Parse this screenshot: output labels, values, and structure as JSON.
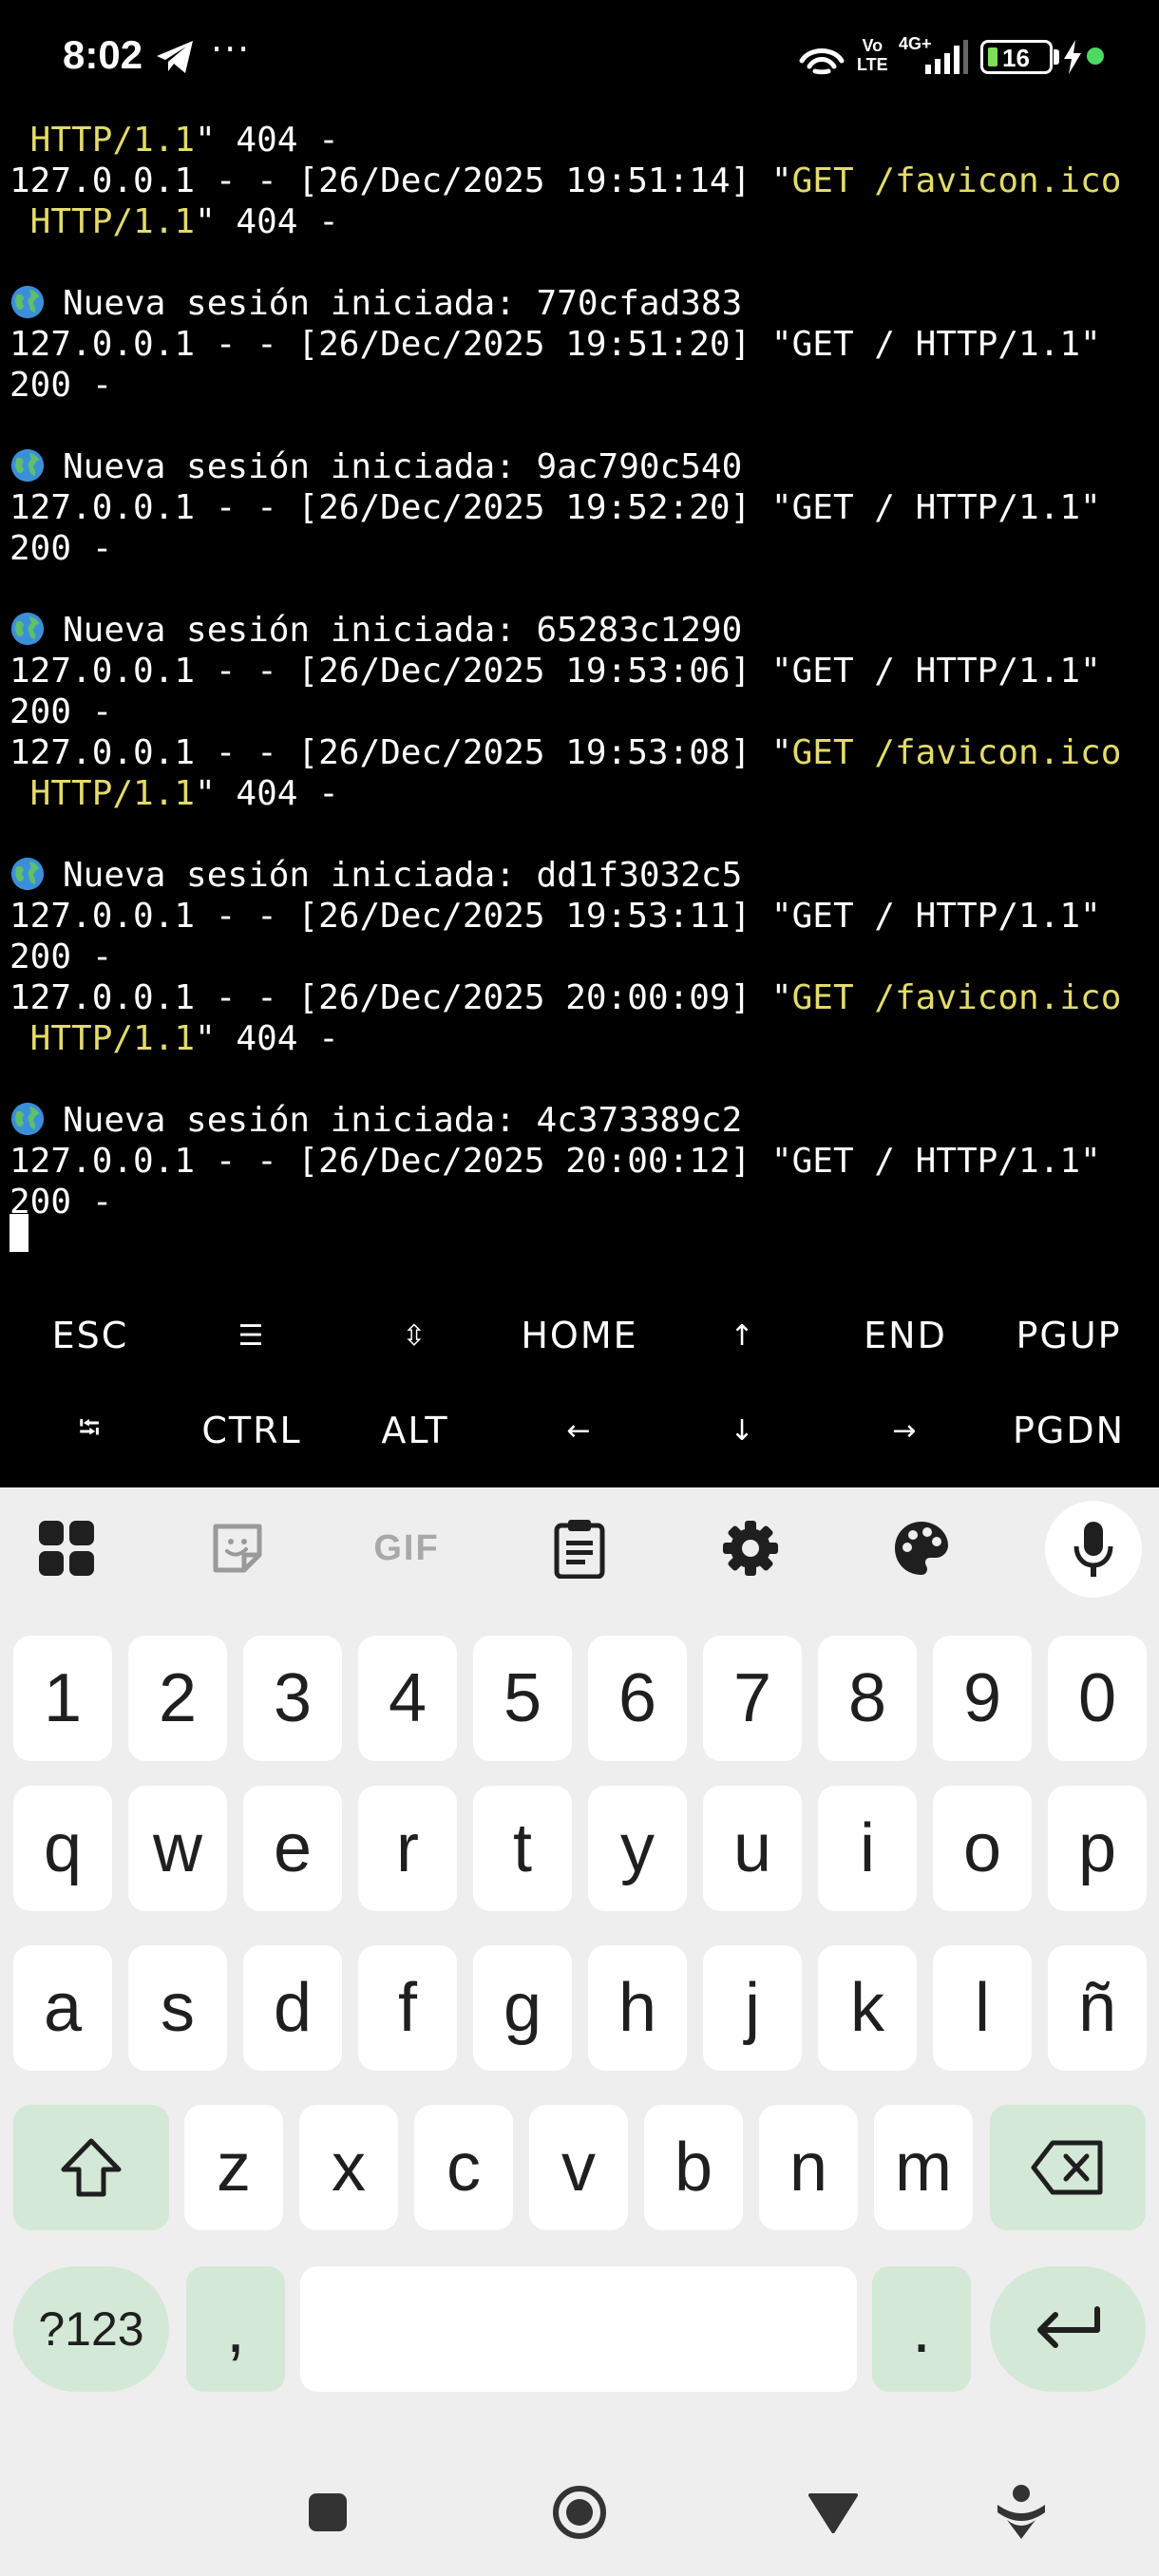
{
  "status_bar": {
    "time": "8:02",
    "overflow": "···",
    "volte": [
      "Vo",
      "LTE"
    ],
    "network": "4G+",
    "battery_level": "16",
    "icons": [
      "telegram-icon",
      "wifi-calling-icon",
      "signal-icon",
      "battery-icon",
      "charging-icon"
    ],
    "dot_color": "#4cd964"
  },
  "terminal": {
    "text_color": "#ffffff",
    "highlight_color": "#e3db6a",
    "lines": [
      {
        "prefix": "",
        "highlight": " HTTP/1.1",
        "suffix": "\" 404 -"
      },
      {
        "prefix": "127.0.0.1 - - [26/Dec/2025 19:51:14] \"",
        "highlight": "GET /favicon.ico",
        "suffix": ""
      },
      {
        "prefix": "",
        "highlight": " HTTP/1.1",
        "suffix": "\" 404 -"
      },
      {
        "prefix": "",
        "highlight": "",
        "suffix": ""
      },
      {
        "globe": true,
        "prefix": "Nueva sesión iniciada: 770cfad383",
        "highlight": "",
        "suffix": ""
      },
      {
        "prefix": "127.0.0.1 - - [26/Dec/2025 19:51:20] \"GET / HTTP/1.1\"",
        "highlight": "",
        "suffix": ""
      },
      {
        "prefix": "200 -",
        "highlight": "",
        "suffix": ""
      },
      {
        "prefix": "",
        "highlight": "",
        "suffix": ""
      },
      {
        "globe": true,
        "prefix": "Nueva sesión iniciada: 9ac790c540",
        "highlight": "",
        "suffix": ""
      },
      {
        "prefix": "127.0.0.1 - - [26/Dec/2025 19:52:20] \"GET / HTTP/1.1\"",
        "highlight": "",
        "suffix": ""
      },
      {
        "prefix": "200 -",
        "highlight": "",
        "suffix": ""
      },
      {
        "prefix": "",
        "highlight": "",
        "suffix": ""
      },
      {
        "globe": true,
        "prefix": "Nueva sesión iniciada: 65283c1290",
        "highlight": "",
        "suffix": ""
      },
      {
        "prefix": "127.0.0.1 - - [26/Dec/2025 19:53:06] \"GET / HTTP/1.1\"",
        "highlight": "",
        "suffix": ""
      },
      {
        "prefix": "200 -",
        "highlight": "",
        "suffix": ""
      },
      {
        "prefix": "127.0.0.1 - - [26/Dec/2025 19:53:08] \"",
        "highlight": "GET /favicon.ico",
        "suffix": ""
      },
      {
        "prefix": "",
        "highlight": " HTTP/1.1",
        "suffix": "\" 404 -"
      },
      {
        "prefix": "",
        "highlight": "",
        "suffix": ""
      },
      {
        "globe": true,
        "prefix": "Nueva sesión iniciada: dd1f3032c5",
        "highlight": "",
        "suffix": ""
      },
      {
        "prefix": "127.0.0.1 - - [26/Dec/2025 19:53:11] \"GET / HTTP/1.1\"",
        "highlight": "",
        "suffix": ""
      },
      {
        "prefix": "200 -",
        "highlight": "",
        "suffix": ""
      },
      {
        "prefix": "127.0.0.1 - - [26/Dec/2025 20:00:09] \"",
        "highlight": "GET /favicon.ico",
        "suffix": ""
      },
      {
        "prefix": "",
        "highlight": " HTTP/1.1",
        "suffix": "\" 404 -"
      },
      {
        "prefix": "",
        "highlight": "",
        "suffix": ""
      },
      {
        "globe": true,
        "prefix": "Nueva sesión iniciada: 4c373389c2",
        "highlight": "",
        "suffix": ""
      },
      {
        "prefix": "127.0.0.1 - - [26/Dec/2025 20:00:12] \"GET / HTTP/1.1\"",
        "highlight": "",
        "suffix": ""
      },
      {
        "prefix": "200 -",
        "highlight": "",
        "suffix": ""
      }
    ]
  },
  "extra_keys": {
    "row1": [
      {
        "name": "esc",
        "label": "ESC"
      },
      {
        "name": "drawer",
        "label": "☰"
      },
      {
        "name": "scroll",
        "label": "⇳"
      },
      {
        "name": "home",
        "label": "HOME"
      },
      {
        "name": "up",
        "label": "↑"
      },
      {
        "name": "end",
        "label": "END"
      },
      {
        "name": "pgup",
        "label": "PGUP"
      }
    ],
    "row2": [
      {
        "name": "tab",
        "label": "⭾"
      },
      {
        "name": "ctrl",
        "label": "CTRL"
      },
      {
        "name": "alt",
        "label": "ALT"
      },
      {
        "name": "left",
        "label": "←"
      },
      {
        "name": "down",
        "label": "↓"
      },
      {
        "name": "right",
        "label": "→"
      },
      {
        "name": "pgdn",
        "label": "PGDN"
      }
    ]
  },
  "keyboard": {
    "toolbar": [
      "apps-icon",
      "sticker-icon",
      "gif-icon",
      "clipboard-icon",
      "settings-icon",
      "theme-icon",
      "mic-icon"
    ],
    "gif_label": "GIF",
    "accent_color": "#d3e8d6",
    "row_numbers": [
      "1",
      "2",
      "3",
      "4",
      "5",
      "6",
      "7",
      "8",
      "9",
      "0"
    ],
    "row_top": [
      "q",
      "w",
      "e",
      "r",
      "t",
      "y",
      "u",
      "i",
      "o",
      "p"
    ],
    "row_home": [
      "a",
      "s",
      "d",
      "f",
      "g",
      "h",
      "j",
      "k",
      "l",
      "ñ"
    ],
    "row_bottom": [
      "z",
      "x",
      "c",
      "v",
      "b",
      "n",
      "m"
    ],
    "symbols_label": "?123",
    "comma_label": ",",
    "period_label": ".",
    "space_label": ""
  },
  "nav_bar": {
    "icons": [
      "recents-icon",
      "home-icon",
      "back-icon",
      "assistant-icon"
    ]
  }
}
